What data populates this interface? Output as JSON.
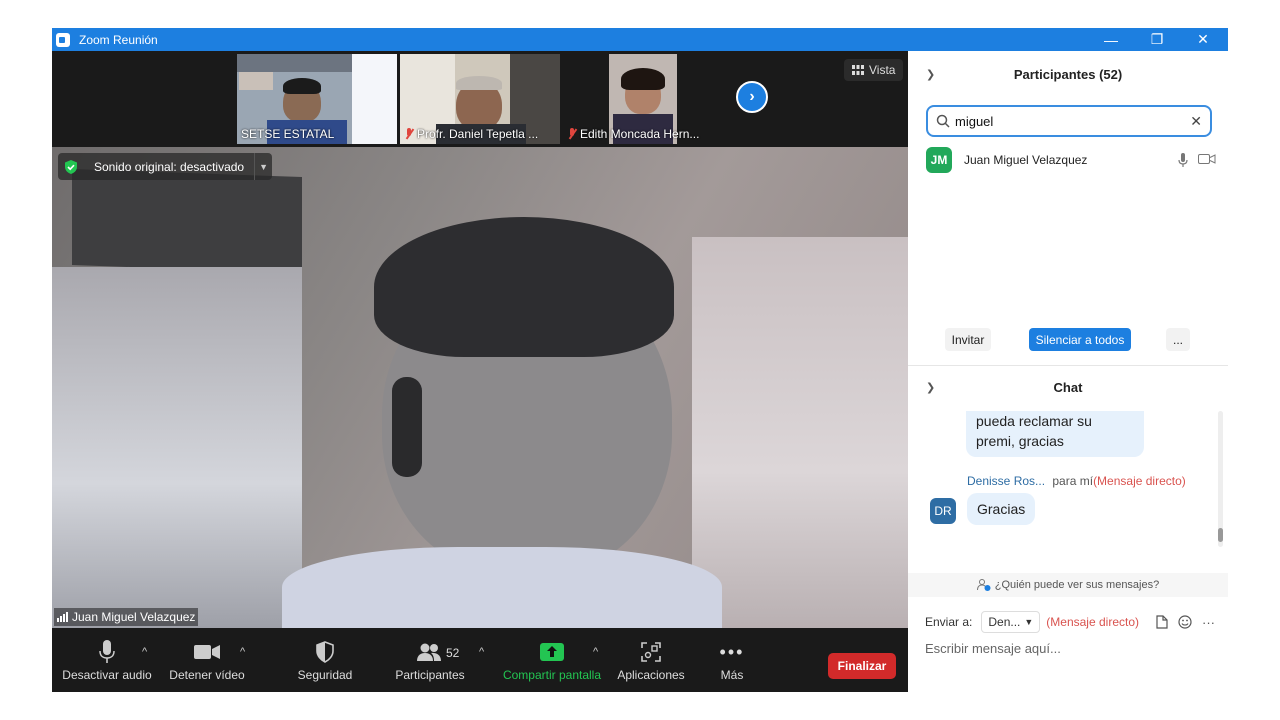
{
  "window": {
    "title": "Zoom Reunión",
    "minimize_glyph": "—",
    "restore_glyph": "❐",
    "close_glyph": "✕"
  },
  "thumbnails": [
    {
      "name": "SETSE ESTATAL",
      "muted": false
    },
    {
      "name": "Profr. Daniel Tepetla ...",
      "muted": true
    },
    {
      "name": "Edith Moncada Hern...",
      "muted": true
    }
  ],
  "view_button": {
    "label": "Vista",
    "icon": "grid-icon"
  },
  "main_video": {
    "sound_label": "Sonido original: desactivado",
    "speaker_name": "Juan Miguel Velazquez"
  },
  "toolbar": {
    "audio": "Desactivar audio",
    "video": "Detener vídeo",
    "security": "Seguridad",
    "participants": "Participantes",
    "participants_count": "52",
    "share": "Compartir pantalla",
    "apps": "Aplicaciones",
    "more": "Más",
    "end": "Finalizar"
  },
  "participants_panel": {
    "title": "Participantes (52)",
    "search_value": "miguel",
    "results": [
      {
        "initials": "JM",
        "name": "Juan Miguel Velazquez",
        "avatar_color": "#22a85a"
      }
    ],
    "invite": "Invitar",
    "mute_all": "Silenciar a todos",
    "more": "..."
  },
  "chat_panel": {
    "title": "Chat",
    "messages": [
      {
        "text": "pueda reclamar su premi, gracias"
      },
      {
        "sender": "Denisse Ros...",
        "to": "para mí",
        "tag": "(Mensaje directo)",
        "initials": "DR",
        "avatar_color": "#2e6da4",
        "text": "Gracias"
      }
    ],
    "who_can_see": "¿Quién puede ver sus mensajes?",
    "send_to_label": "Enviar a:",
    "send_to_value": "Den...",
    "send_to_tag": "(Mensaje directo)",
    "input_placeholder": "Escribir mensaje aquí..."
  },
  "colors": {
    "accent": "#1d7fe0",
    "end_red": "#d22a2a",
    "share_green": "#23c552",
    "dm_red": "#d9534f"
  }
}
